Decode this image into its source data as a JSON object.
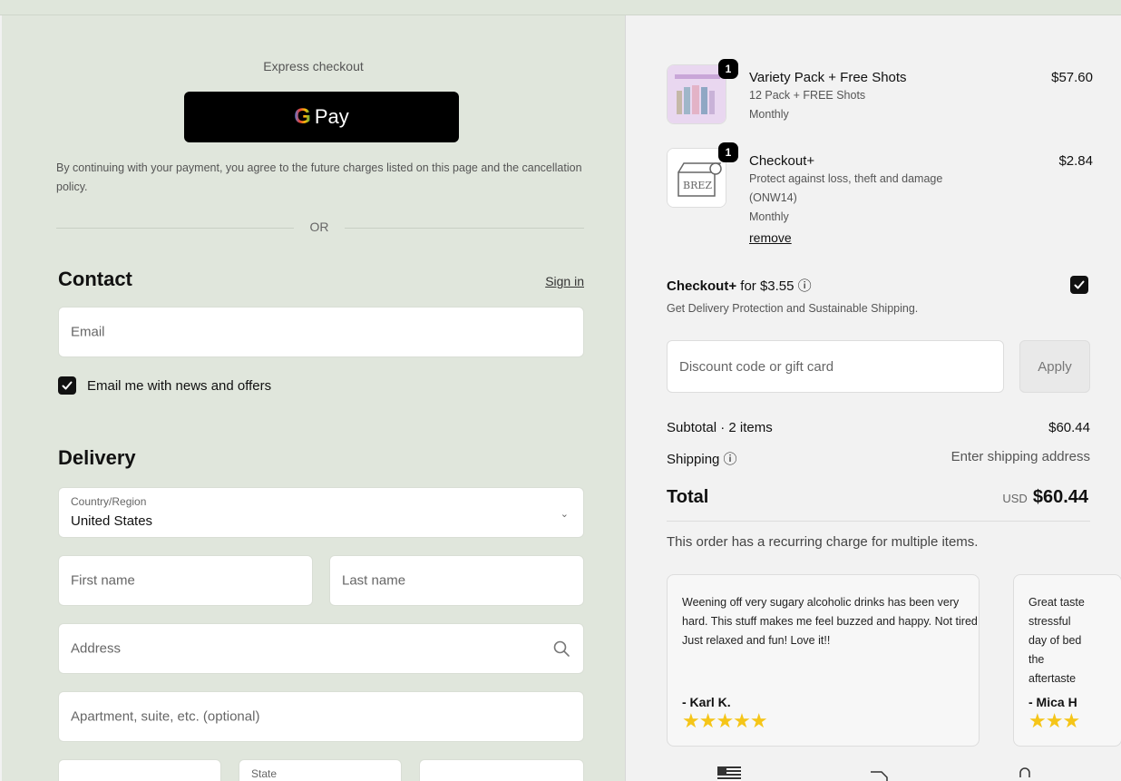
{
  "express": {
    "title": "Express checkout",
    "gpay_g": "G",
    "gpay_label": "Pay",
    "consent": "By continuing with your payment, you agree to the future charges listed on this page and the cancellation policy.",
    "or": "OR"
  },
  "contact": {
    "heading": "Contact",
    "sign_in": "Sign in",
    "email_placeholder": "Email",
    "newsletter_label": "Email me with news and offers",
    "newsletter_checked": true
  },
  "delivery": {
    "heading": "Delivery",
    "country_label": "Country/Region",
    "country_value": "United States",
    "first_name": "First name",
    "last_name": "Last name",
    "address": "Address",
    "apartment": "Apartment, suite, etc. (optional)",
    "state_label": "State"
  },
  "order": {
    "items": [
      {
        "qty": "1",
        "name": "Variety Pack + Free Shots",
        "sub1": "12 Pack + FREE Shots",
        "sub2": "Monthly",
        "price": "$57.60"
      },
      {
        "qty": "1",
        "name": "Checkout+",
        "sub1": "Protect against loss, theft and damage",
        "sub2": "(ONW14)",
        "sub3": "Monthly",
        "price": "$2.84",
        "remove": "remove",
        "thumb_text": "BREZ"
      }
    ],
    "checkout_plus": {
      "title_bold": "Checkout+",
      "title_rest": " for $3.55 ⓘ",
      "subtitle": "Get Delivery Protection and Sustainable Shipping.",
      "checked": true
    },
    "discount_placeholder": "Discount code or gift card",
    "apply_label": "Apply",
    "subtotal_label": "Subtotal · 2 items",
    "subtotal_value": "$60.44",
    "shipping_label": "Shipping ⓘ",
    "shipping_value": "Enter shipping address",
    "total_label": "Total",
    "total_currency": "USD",
    "total_value": "$60.44",
    "recurring_note": "This order has a recurring charge for multiple items."
  },
  "reviews": [
    {
      "text": "Weening off very sugary alcoholic drinks has been very hard. This stuff makes me feel buzzed and happy. Not tired! Just relaxed and fun! Love it!!",
      "author": "- Karl K.",
      "stars": "★★★★★"
    },
    {
      "text": "Great taste stressful day of bed the aftertaste",
      "author": "- Mica H",
      "stars": "★★★"
    }
  ],
  "colors": {
    "left_bg": "#e0e6dc",
    "right_bg": "#f2f2f2",
    "star": "#f5c518"
  }
}
